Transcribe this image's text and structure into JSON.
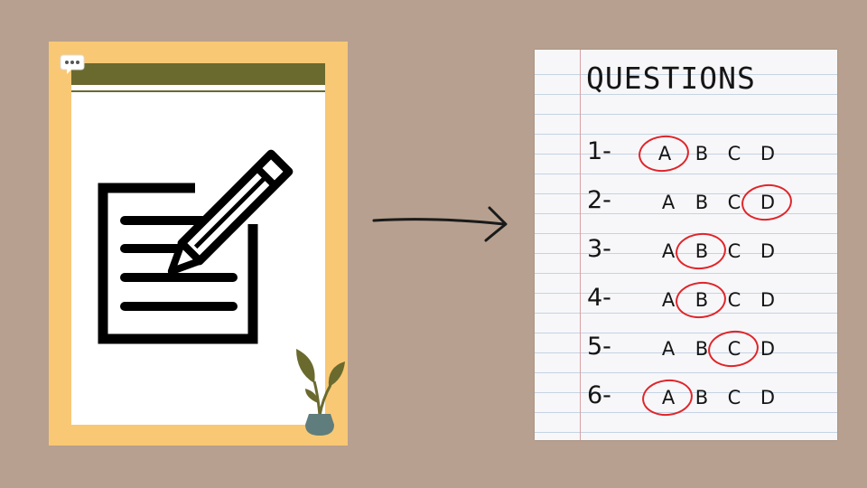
{
  "paper": {
    "title": "QUESTIONS",
    "questions": [
      {
        "number": "1-",
        "options": [
          "A",
          "B",
          "C",
          "D"
        ],
        "circled": "A"
      },
      {
        "number": "2-",
        "options": [
          "A",
          "B",
          "C",
          "D"
        ],
        "circled": "D"
      },
      {
        "number": "3-",
        "options": [
          "A",
          "B",
          "C",
          "D"
        ],
        "circled": "B"
      },
      {
        "number": "4-",
        "options": [
          "A",
          "B",
          "C",
          "D"
        ],
        "circled": "B"
      },
      {
        "number": "5-",
        "options": [
          "A",
          "B",
          "C",
          "D"
        ],
        "circled": "C"
      },
      {
        "number": "6-",
        "options": [
          "A",
          "B",
          "C",
          "D"
        ],
        "circled": "A"
      }
    ]
  },
  "colors": {
    "background": "#b7a08f",
    "card_frame": "#f9c874",
    "card_header": "#6a6a2e",
    "circle": "#e0252a"
  },
  "icons": [
    "chat-bubble-icon",
    "write-document-icon",
    "plant-icon",
    "right-arrow-icon"
  ]
}
